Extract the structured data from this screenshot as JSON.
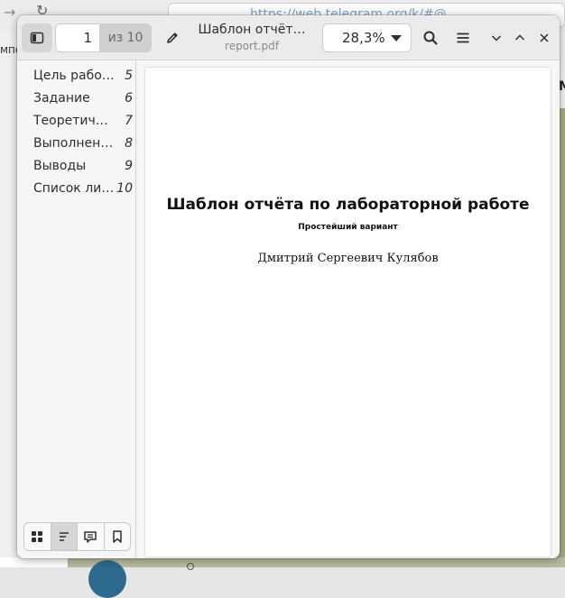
{
  "background": {
    "url": "https://web.telegram.org/k/#@...",
    "tab_fragment": "мпо",
    "right_letter": "M"
  },
  "toolbar": {
    "current_page": "1",
    "page_total": "из 10",
    "doc_title": "Шаблон отчёт…",
    "doc_filename": "report.pdf",
    "zoom": "28,3%",
    "icons": [
      "sidebar-icon",
      "pencil-icon",
      "search-icon",
      "hamburger-menu-icon",
      "chevron-down-icon",
      "chevron-up-icon",
      "close-icon"
    ]
  },
  "outline": [
    {
      "label": "Цель работы",
      "page": "5"
    },
    {
      "label": "Задание",
      "page": "6"
    },
    {
      "label": "Теоретиче…",
      "page": "7"
    },
    {
      "label": "Выполнени…",
      "page": "8"
    },
    {
      "label": "Выводы",
      "page": "9"
    },
    {
      "label": "Список лит…",
      "page": "10"
    }
  ],
  "sidebar_tabs": [
    "thumbnails-icon",
    "outline-icon",
    "annotations-icon",
    "bookmarks-icon"
  ],
  "document": {
    "title": "Шаблон отчёта по лабораторной работе",
    "subtitle": "Простейший вариант",
    "author": "Дмитрий Сергеевич Кулябов"
  },
  "colors": {
    "headerbar": "#ebebeb",
    "active_button": "#d6d6d6",
    "text": "#2e2e2e"
  }
}
